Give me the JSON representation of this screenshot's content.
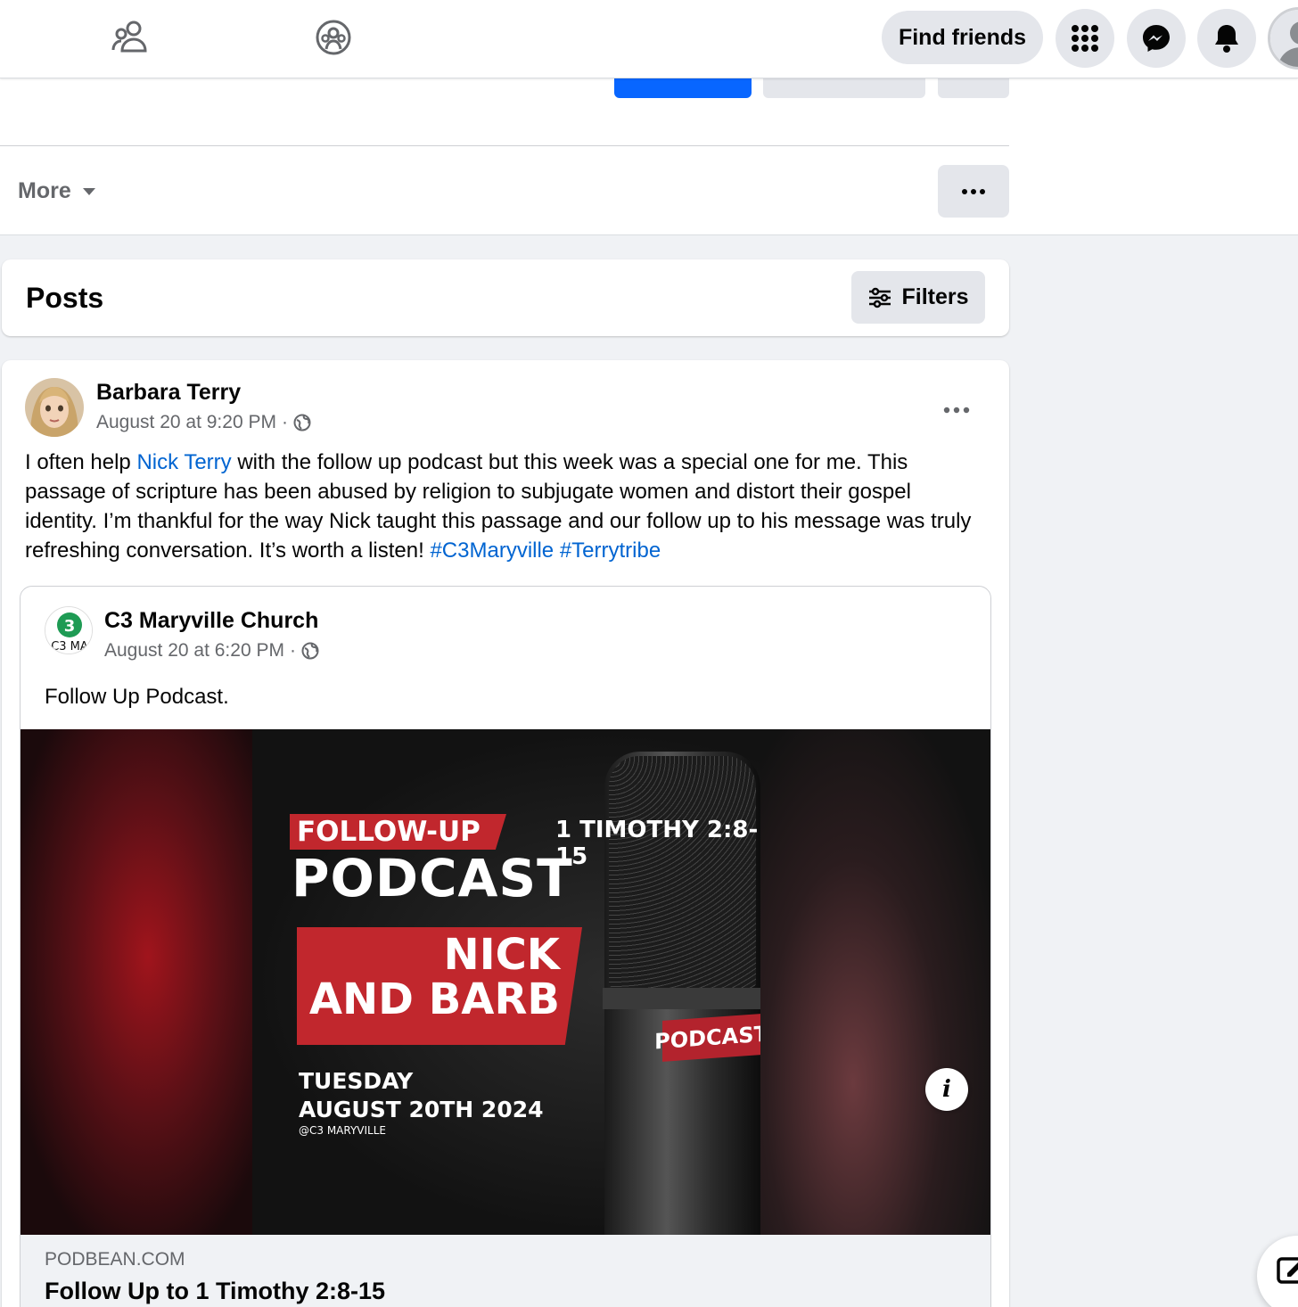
{
  "nav": {
    "find_friends": "Find friends",
    "icons": [
      "friends-icon",
      "groups-icon",
      "menu-grid-icon",
      "messenger-icon",
      "notifications-icon",
      "profile-avatar"
    ]
  },
  "tabs": {
    "more_label": "More"
  },
  "posts_section": {
    "title": "Posts",
    "filters_label": "Filters"
  },
  "post": {
    "author": "Barbara Terry",
    "timestamp": "August 20 at 9:20 PM",
    "separator": "·",
    "body": {
      "part1": "I often help ",
      "mention": "Nick Terry",
      "part2": " with the follow up podcast but this week was a special one for me. This passage of scripture has been abused by religion to subjugate women and distort their gospel identity. I’m thankful for the way Nick taught this passage and our follow up to his message was truly refreshing conversation. It’s worth a listen! ",
      "hashtag1": "#C3Maryville",
      "hashtag2": "#Terrytribe"
    },
    "shared": {
      "author": "C3 Maryville Church",
      "avatar_text": "C3 MA",
      "timestamp": "August 20 at 6:20 PM",
      "separator": "·",
      "text": "Follow Up Podcast.",
      "poster": {
        "follow_up": "FOLLOW-UP",
        "podcast": "PODCAST",
        "scripture": "1 TIMOTHY 2:8-15",
        "names_line1": "NICK",
        "names_line2": "AND BARB",
        "day": "TUESDAY",
        "date": "AUGUST 20TH 2024",
        "handle": "@C3 MARYVILLE",
        "mic_label": "PODCAST"
      },
      "link_domain": "PODBEAN.COM",
      "link_title": "Follow Up to 1 Timothy 2:8-15"
    }
  },
  "colors": {
    "accent": "#0866ff",
    "link": "#0064d1",
    "poster_red": "#c1272d"
  }
}
